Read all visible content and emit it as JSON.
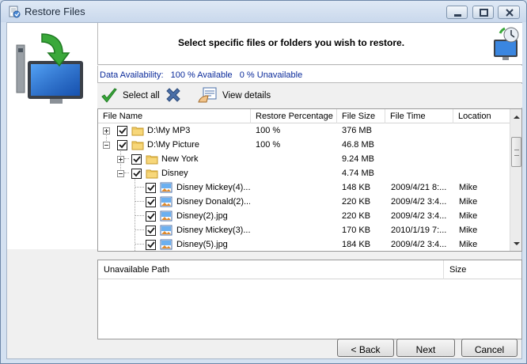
{
  "window": {
    "title": "Restore Files",
    "controls": [
      "minimize",
      "maximize",
      "close"
    ]
  },
  "header": {
    "instruction": "Select specific files or folders you wish to restore."
  },
  "availability": {
    "label": "Data Availability:",
    "available": "100 % Available",
    "unavailable": "0 % Unavailable"
  },
  "toolbar": {
    "select_all": "Select all",
    "deselect_icon": "x-icon",
    "view_details": "View details"
  },
  "file_list": {
    "columns": [
      "File Name",
      "Restore Percentage",
      "File Size",
      "File Time",
      "Location"
    ],
    "rows": [
      {
        "name": "D:\\My MP3",
        "percent": "100 %",
        "size": "376 MB",
        "time": "",
        "location": "",
        "type": "folder",
        "level": 0,
        "expander": "plus",
        "checked": true
      },
      {
        "name": "D:\\My Picture",
        "percent": "100 %",
        "size": "46.8 MB",
        "time": "",
        "location": "",
        "type": "folder",
        "level": 0,
        "expander": "minus",
        "checked": true
      },
      {
        "name": "New York",
        "percent": "",
        "size": "9.24 MB",
        "time": "",
        "location": "",
        "type": "folder",
        "level": 1,
        "expander": "plus",
        "checked": true
      },
      {
        "name": "Disney",
        "percent": "",
        "size": "4.74 MB",
        "time": "",
        "location": "",
        "type": "folder",
        "level": 1,
        "expander": "minus",
        "checked": true
      },
      {
        "name": "Disney Mickey(4)...",
        "percent": "",
        "size": "148 KB",
        "time": "2009/4/21 8:...",
        "location": "Mike",
        "type": "image",
        "level": 2,
        "expander": "",
        "checked": true
      },
      {
        "name": "Disney Donald(2)...",
        "percent": "",
        "size": "220 KB",
        "time": "2009/4/2 3:4...",
        "location": "Mike",
        "type": "image",
        "level": 2,
        "expander": "",
        "checked": true
      },
      {
        "name": "Disney(2).jpg",
        "percent": "",
        "size": "220 KB",
        "time": "2009/4/2 3:4...",
        "location": "Mike",
        "type": "image",
        "level": 2,
        "expander": "",
        "checked": true
      },
      {
        "name": "Disney Mickey(3)...",
        "percent": "",
        "size": "170 KB",
        "time": "2010/1/19 7:...",
        "location": "Mike",
        "type": "image",
        "level": 2,
        "expander": "",
        "checked": true
      },
      {
        "name": "Disney(5).jpg",
        "percent": "",
        "size": "184 KB",
        "time": "2009/4/2 3:4...",
        "location": "Mike",
        "type": "image",
        "level": 2,
        "expander": "",
        "checked": true
      }
    ]
  },
  "unavailable_list": {
    "columns": [
      "Unavailable Path",
      "Size"
    ],
    "rows": []
  },
  "buttons": {
    "back": "< Back",
    "next": "Next",
    "cancel": "Cancel"
  },
  "colors": {
    "availability_text": "#0a2a9a",
    "window_frame": "#d4e1f1",
    "accent_green": "#3aa83a"
  }
}
